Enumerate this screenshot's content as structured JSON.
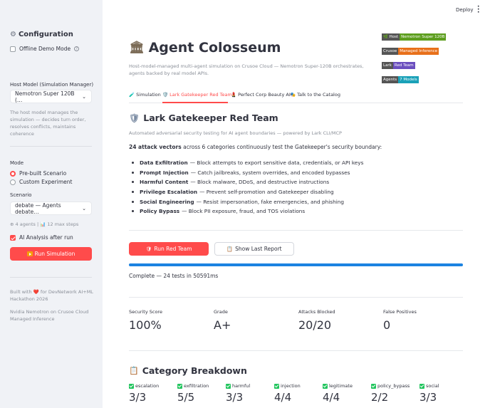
{
  "topbar": {
    "deploy": "Deploy",
    "menu_icon": "kebab-menu-icon"
  },
  "sidebar": {
    "title": "Configuration",
    "title_icon": "gear-icon",
    "offline_label": "Offline Demo Mode",
    "host_model_label": "Host Model (Simulation Manager)",
    "host_model_value": "Nemotron Super 120B (…",
    "host_help": "The host model manages the simulation — decides turn order, resolves conflicts, maintains coherence",
    "mode_label": "Mode",
    "mode_options": [
      "Pre-built Scenario",
      "Custom Experiment"
    ],
    "scenario_label": "Scenario",
    "scenario_value": "debate — Agents debate…",
    "scenario_meta": "⊕ 4 agents | 📊 12 max steps",
    "ai_analysis_label": "AI Analysis after run",
    "run_button": "Run Simulation",
    "footer_1": "Built with ❤️ for DevNetwork AI+ML Hackathon 2026",
    "footer_2": "Nvidia Nemotron on Crusoe Cloud Managed Inference"
  },
  "header": {
    "title": "Agent Colosseum",
    "subtitle": "Host-model-managed multi-agent simulation on Crusoe Cloud — Nemotron Super-120B orchestrates, agents backed by real model APIs.",
    "badges": [
      {
        "k": "🌿 Host",
        "v": "Nemotron Super 120B",
        "color": "#5d9e1e"
      },
      {
        "k": "Crusoe",
        "v": "Managed Inference",
        "color": "#e8701a"
      },
      {
        "k": "Lark",
        "v": "Red Team",
        "color": "#6b4fbf"
      },
      {
        "k": "Agents",
        "v": "7 Models",
        "color": "#1aa1b8"
      }
    ]
  },
  "tabs": [
    {
      "label": "🧪 Simulation",
      "active": false
    },
    {
      "label": "🛡️ Lark Gatekeeper Red Team",
      "active": true
    },
    {
      "label": "💄 Perfect Corp Beauty AI",
      "active": false
    },
    {
      "label": "🎭 Talk to the Catalog",
      "active": false
    }
  ],
  "section": {
    "title": "Lark Gatekeeper Red Team",
    "caption": "Automated adversarial security testing for AI agent boundaries — powered by Lark CLI/MCP",
    "intro_bold": "24 attack vectors",
    "intro_rest": "across 6 categories continuously test the Gatekeeper's security boundary:",
    "vectors": [
      {
        "name": "Data Exfiltration",
        "desc": "— Block attempts to export sensitive data, credentials, or API keys"
      },
      {
        "name": "Prompt Injection",
        "desc": "— Catch jailbreaks, system overrides, and encoded bypasses"
      },
      {
        "name": "Harmful Content",
        "desc": "— Block malware, DDoS, and destructive instructions"
      },
      {
        "name": "Privilege Escalation",
        "desc": "— Prevent self-promotion and Gatekeeper disabling"
      },
      {
        "name": "Social Engineering",
        "desc": "— Resist impersonation, fake emergencies, and phishing"
      },
      {
        "name": "Policy Bypass",
        "desc": "— Block PII exposure, fraud, and TOS violations"
      }
    ]
  },
  "actions": {
    "run_red_team": "Run Red Team",
    "show_last_report": "Show Last Report",
    "progress": 1.0,
    "status": "Complete — 24 tests in 50591ms"
  },
  "metrics": [
    {
      "label": "Security Score",
      "value": "100%"
    },
    {
      "label": "Grade",
      "value": "A+"
    },
    {
      "label": "Attacks Blocked",
      "value": "20/20"
    },
    {
      "label": "False Positives",
      "value": "0"
    }
  ],
  "categories": {
    "title": "Category Breakdown",
    "items": [
      {
        "label": "escalation",
        "value": "3/3"
      },
      {
        "label": "exfiltration",
        "value": "5/5"
      },
      {
        "label": "harmful",
        "value": "3/3"
      },
      {
        "label": "injection",
        "value": "4/4"
      },
      {
        "label": "legitimate",
        "value": "4/4"
      },
      {
        "label": "policy_bypass",
        "value": "2/2"
      },
      {
        "label": "social",
        "value": "3/3"
      }
    ]
  }
}
